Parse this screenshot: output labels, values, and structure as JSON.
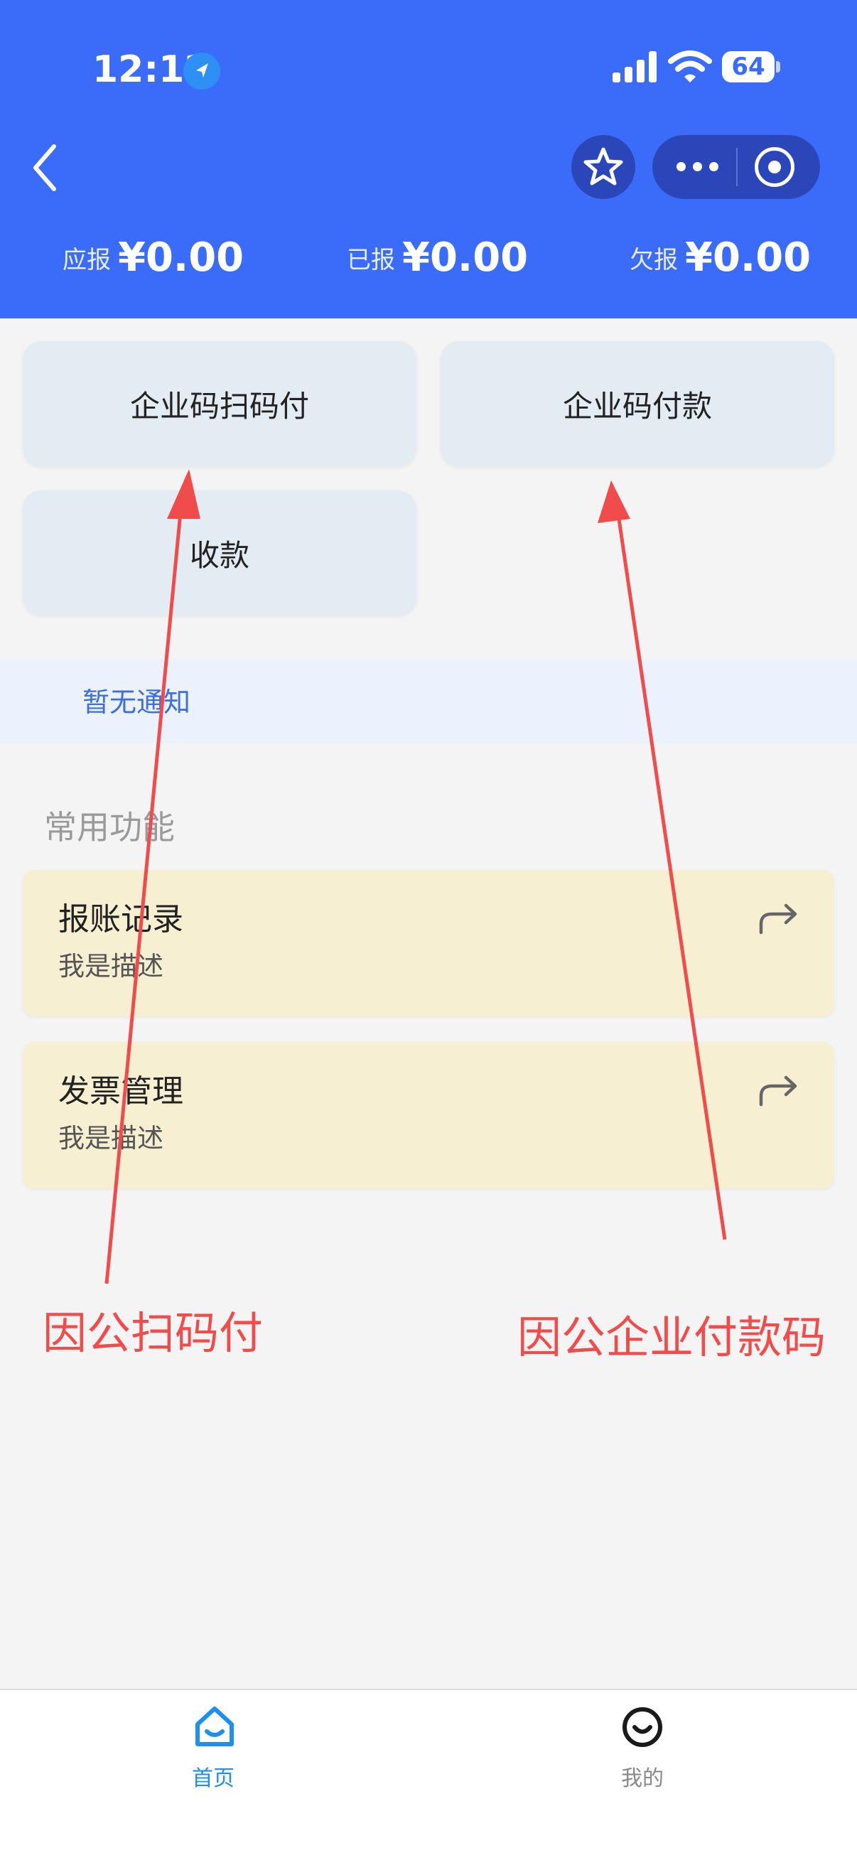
{
  "status_bar": {
    "time": "12:12",
    "battery": "64",
    "icons": [
      "location-arrow-icon",
      "cellular-signal-icon",
      "wifi-icon",
      "battery-icon"
    ]
  },
  "nav": {
    "icons": [
      "back-chevron-icon",
      "star-icon",
      "more-dots-icon",
      "target-icon"
    ]
  },
  "summary": [
    {
      "label": "应报",
      "value": "¥0.00"
    },
    {
      "label": "已报",
      "value": "¥0.00"
    },
    {
      "label": "欠报",
      "value": "¥0.00"
    }
  ],
  "actions": {
    "scan_pay": "企业码扫码付",
    "code_pay": "企业码付款",
    "receive": "收款"
  },
  "notice": {
    "text": "暂无通知"
  },
  "common": {
    "title": "常用功能",
    "items": [
      {
        "title": "报账记录",
        "desc": "我是描述",
        "icon": "share-arrow-icon"
      },
      {
        "title": "发票管理",
        "desc": "我是描述",
        "icon": "share-arrow-icon"
      }
    ]
  },
  "annotations": {
    "left": "因公扫码付",
    "right": "因公企业付款码",
    "color": "#f14c4c"
  },
  "tabbar": {
    "items": [
      {
        "label": "首页",
        "icon": "home-icon",
        "active": true
      },
      {
        "label": "我的",
        "icon": "smile-face-icon",
        "active": false
      }
    ]
  },
  "colors": {
    "header": "#3a6cf9",
    "tile": "#e3ebf3",
    "notice_bg": "#ecf2fd",
    "notice_text": "#3d6ee0",
    "card": "#f6efd1",
    "tab_active": "#1f8ef1",
    "tab_inactive": "#888888"
  }
}
